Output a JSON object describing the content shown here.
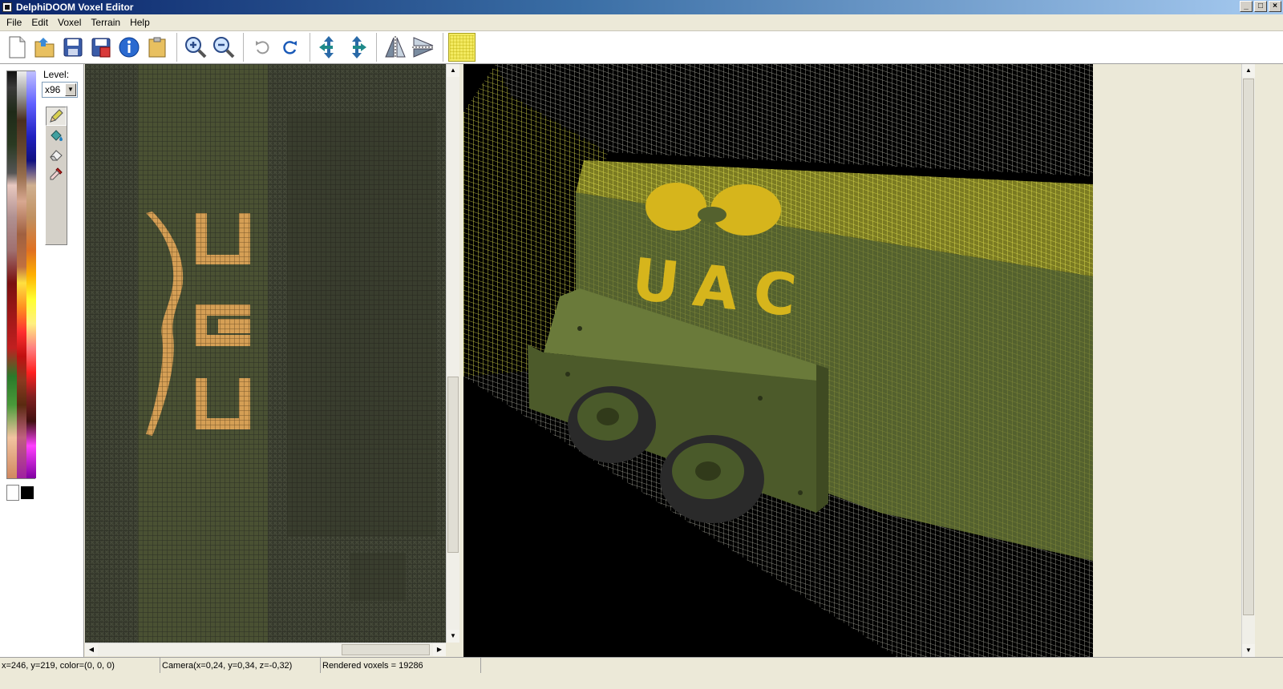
{
  "window": {
    "title": "DelphiDOOM Voxel Editor",
    "controls": [
      "_",
      "□",
      "×"
    ]
  },
  "menu": {
    "items": [
      "File",
      "Edit",
      "Voxel",
      "Terrain",
      "Help"
    ]
  },
  "toolbar": {
    "buttons": [
      "new-document-icon",
      "open-folder-icon",
      "save-icon",
      "save-as-icon",
      "info-icon",
      "open-palette-icon",
      "zoom-in-icon",
      "zoom-out-icon",
      "undo-icon",
      "redo-icon",
      "rotate-left-icon",
      "rotate-right-icon",
      "mirror-horizontal-icon",
      "mirror-vertical-icon",
      "grid-toggle-icon"
    ]
  },
  "left_panel": {
    "level_label": "Level:",
    "level_value": "x96",
    "tools": [
      "pencil-icon",
      "fill-bucket-icon",
      "eraser-icon",
      "eyedropper-icon"
    ]
  },
  "preview": {
    "logo_text": "UAC"
  },
  "status": {
    "cursor": "x=246, y=219, color=(0, 0, 0)",
    "camera": "Camera(x=0,24, y=0,34, z=-0,32)",
    "rendered": "Rendered voxels = 19286"
  },
  "colors": {
    "grid_bg": "#3d4231",
    "voxel_green": "#4a5530",
    "voxel_orange": "#d9a35a",
    "wire_yellow": "#e8e850",
    "logo_yellow": "#d6b51c"
  }
}
